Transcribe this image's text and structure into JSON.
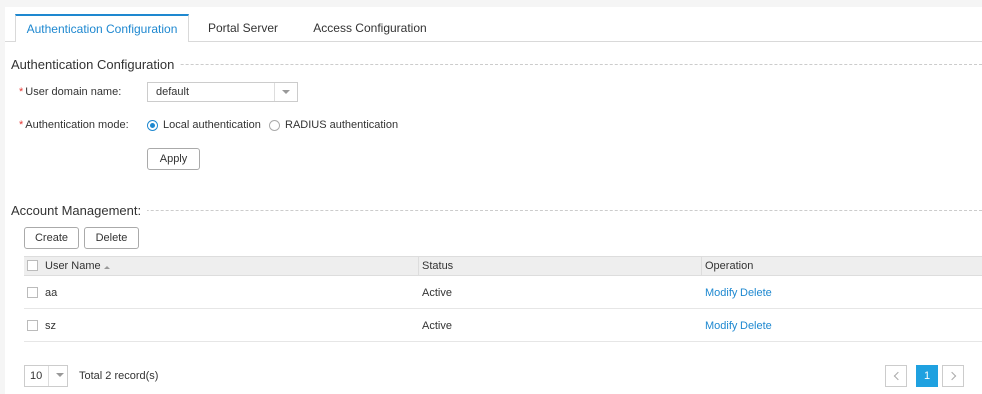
{
  "tabs": [
    {
      "label": "Authentication Configuration",
      "active": true
    },
    {
      "label": "Portal Server",
      "active": false
    },
    {
      "label": "Access Configuration",
      "active": false
    }
  ],
  "auth_section": {
    "title": "Authentication Configuration",
    "user_domain": {
      "required": "*",
      "label": "User domain name:",
      "value": "default"
    },
    "auth_mode": {
      "required": "*",
      "label": "Authentication mode:",
      "options": [
        {
          "label": "Local authentication",
          "selected": true
        },
        {
          "label": "RADIUS authentication",
          "selected": false
        }
      ]
    },
    "apply_label": "Apply"
  },
  "account_section": {
    "title": "Account Management:",
    "create_label": "Create",
    "delete_label": "Delete",
    "columns": [
      "User Name",
      "Status",
      "Operation"
    ],
    "rows": [
      {
        "user": "aa",
        "status": "Active",
        "ops": [
          "Modify",
          "Delete"
        ]
      },
      {
        "user": "sz",
        "status": "Active",
        "ops": [
          "Modify",
          "Delete"
        ]
      }
    ]
  },
  "footer": {
    "page_size": "10",
    "total": "Total 2 record(s)",
    "current_page": "1"
  },
  "colors": {
    "accent": "#1e88d0",
    "page_active": "#1fa1e0",
    "required": "#e53935"
  }
}
